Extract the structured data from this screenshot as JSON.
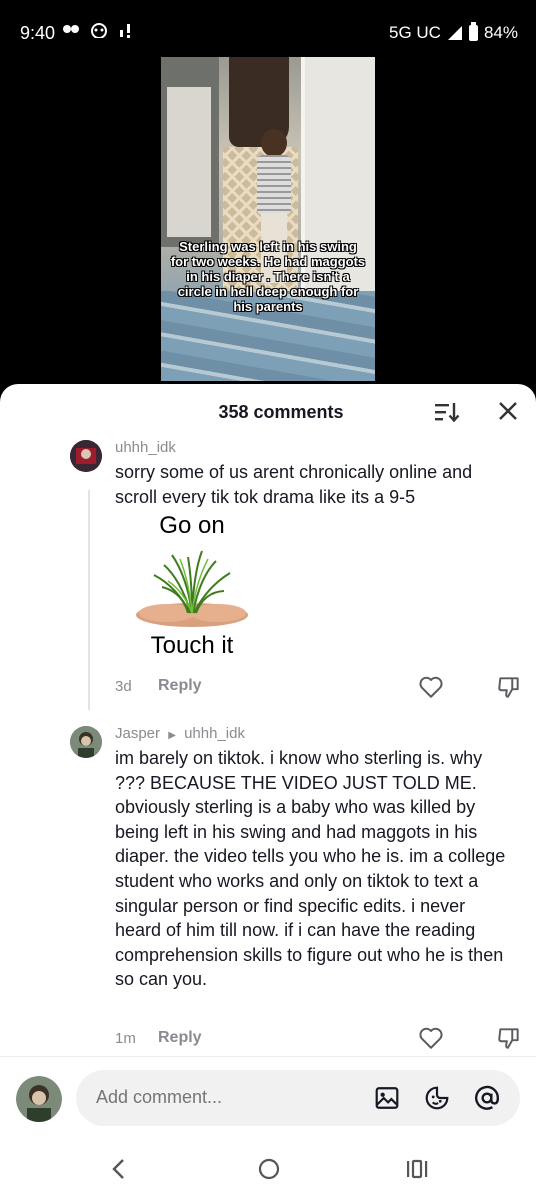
{
  "status_bar": {
    "time": "9:40",
    "network": "5G UC",
    "battery": "84%"
  },
  "video": {
    "caption": "Sterling was left in his swing for two weeks. He had maggots in his diaper . There isn't a circle in hell deep enough for his parents"
  },
  "sheet": {
    "title": "358 comments",
    "sort_icon": "sort-icon",
    "close_icon": "close-icon"
  },
  "comments": [
    {
      "username": "uhhh_idk",
      "text": "sorry some of us arent chronically online and scroll every tik tok drama like its a 9-5",
      "image_top_text": "Go on",
      "image_bottom_text": "Touch it",
      "time": "3d",
      "reply_label": "Reply"
    },
    {
      "username": "Jasper",
      "reply_to": "uhhh_idk",
      "text": "im barely on tiktok. i know who sterling is. why ??? BECAUSE THE VIDEO JUST TOLD ME. obviously sterling is a baby who was killed by being left in his swing and had maggots in his diaper. the video tells you who he is. im a college student who works and only on tiktok to text a singular person or find specific edits. i never heard of him till now. if i can have the reading comprehension skills to figure out who he is then so can you.",
      "time": "1m",
      "reply_label": "Reply"
    }
  ],
  "composer": {
    "placeholder": "Add comment..."
  },
  "colors": {
    "sheet_bg": "#ffffff",
    "muted_text": "#8a8b91",
    "pill_bg": "#f1f1f2"
  }
}
